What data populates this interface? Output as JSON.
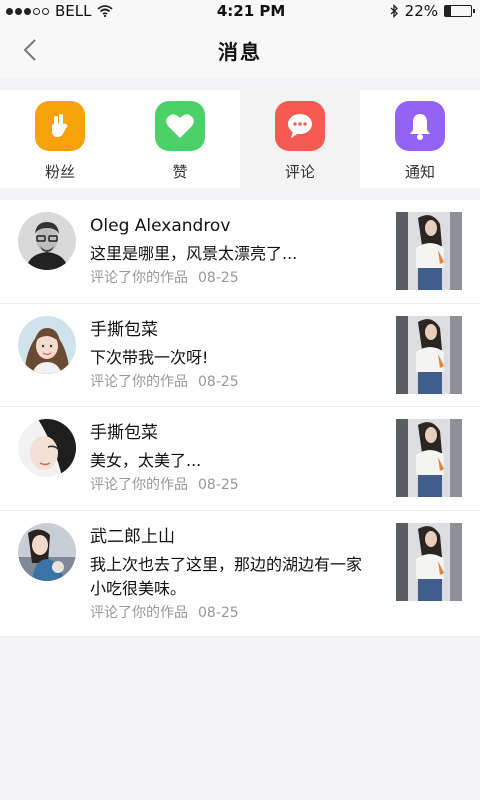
{
  "status": {
    "carrier": "BELL",
    "time": "4:21 PM",
    "battery": "22%",
    "battery_level": 0.22
  },
  "nav": {
    "title": "消息"
  },
  "categories": [
    {
      "label": "粉丝",
      "icon": "hand-icon",
      "color": "#f8a20b"
    },
    {
      "label": "赞",
      "icon": "heart-icon",
      "color": "#4cd168"
    },
    {
      "label": "评论",
      "icon": "comment-bubble-icon",
      "color": "#f75a52"
    },
    {
      "label": "通知",
      "icon": "bell-icon",
      "color": "#9463f5"
    }
  ],
  "active_category": "评论",
  "comments": [
    {
      "name": "Oleg Alexandrov",
      "message": "这里是哪里，风景太漂亮了...",
      "action": "评论了你的作品",
      "date": "08-25"
    },
    {
      "name": "手撕包菜",
      "message": "下次带我一次呀!",
      "action": "评论了你的作品",
      "date": "08-25"
    },
    {
      "name": "手撕包菜",
      "message": "美女，太美了...",
      "action": "评论了你的作品",
      "date": "08-25"
    },
    {
      "name": "武二郎上山",
      "message": "我上次也去了这里，那边的湖边有一家小吃很美味。",
      "action": "评论了你的作品",
      "date": "08-25"
    }
  ]
}
